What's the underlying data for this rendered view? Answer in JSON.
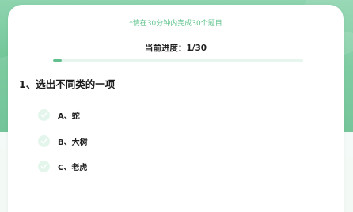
{
  "quiz": {
    "hint": "*请在30分钟内完成30个题目",
    "progress_text": "当前进度：1/30",
    "progress_fraction": 0.0333,
    "question": "1、选出不同类的一项",
    "options": [
      {
        "label": "A、蛇"
      },
      {
        "label": "B、大树"
      },
      {
        "label": "C、老虎"
      }
    ]
  },
  "colors": {
    "accent": "#63c08e",
    "hint_text": "#5fc38c",
    "check_bg": "#e4f6ec",
    "banner": "#6cc494"
  },
  "icons": {
    "option_marker": "check-icon"
  }
}
